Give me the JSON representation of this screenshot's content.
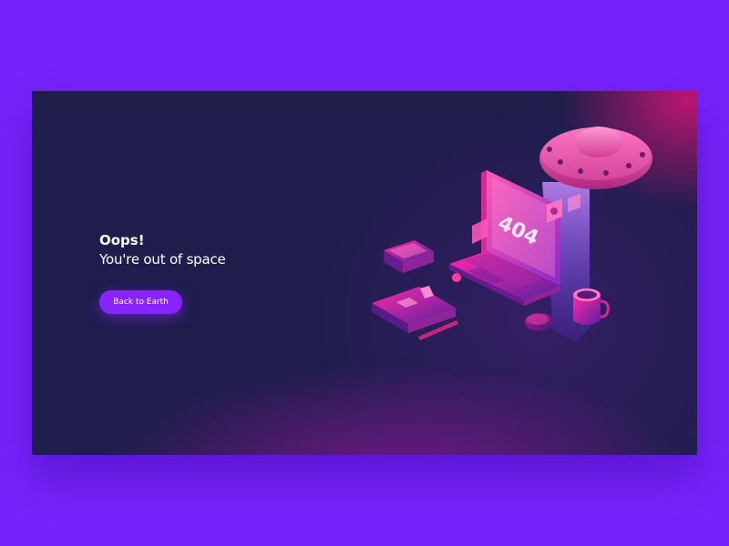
{
  "page": {
    "background_color": "#7622fa",
    "card_color": "#1f1d4c"
  },
  "message": {
    "title": "Oops!",
    "subtitle": "You're out of space"
  },
  "actions": {
    "back_label": "Back to Earth",
    "accent_color": "#8a24ff"
  },
  "illustration": {
    "screen_text": "404",
    "icons": [
      "ufo-icon",
      "laptop-icon",
      "phone-icon",
      "notebook-icon",
      "mouse-icon",
      "coffee-mug-icon",
      "pencil-icon"
    ]
  }
}
